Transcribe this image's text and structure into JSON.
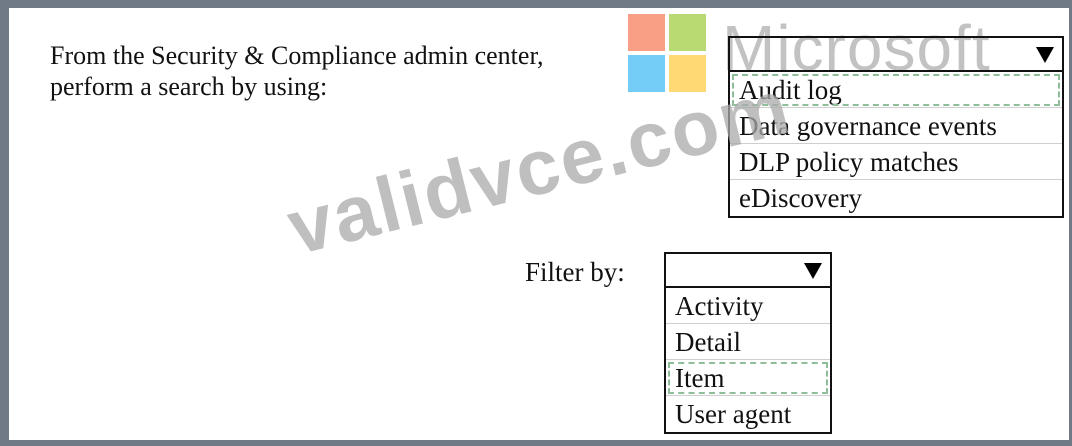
{
  "instruction": {
    "line1": "From the Security & Compliance admin center,",
    "line2": "perform a search by using:"
  },
  "watermarks": {
    "brand": "Microsoft",
    "site": "validvce.com",
    "brand_colors": [
      "#f25022",
      "#7fba00",
      "#00a4ef",
      "#ffb900"
    ]
  },
  "search_dropdown": {
    "selected": "",
    "options": [
      "Audit log",
      "Data governance events",
      "DLP policy matches",
      "eDiscovery"
    ]
  },
  "filter": {
    "label": "Filter by:",
    "selected": "",
    "options": [
      "Activity",
      "Detail",
      "Item",
      "User agent"
    ]
  },
  "colors": {
    "frame": "#6f7a86",
    "answer_hint": "#8fbf9a"
  }
}
